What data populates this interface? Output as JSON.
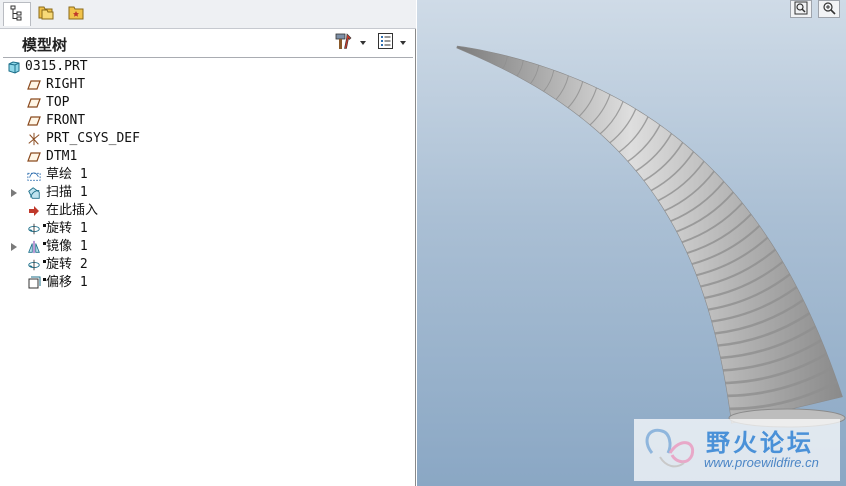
{
  "tabs": [
    {
      "id": "model-tree",
      "icon": "model-tree-tab-icon"
    },
    {
      "id": "folder-browser",
      "icon": "folder-browser-tab-icon"
    },
    {
      "id": "favorites",
      "icon": "favorites-tab-icon"
    }
  ],
  "panel": {
    "title": "模型树",
    "settings_icon": "tools-icon",
    "show_icon": "list-icon"
  },
  "tree": {
    "root": "0315.PRT",
    "items": [
      {
        "label": "RIGHT",
        "icon": "datum-plane-icon",
        "expandable": false,
        "marked": false
      },
      {
        "label": "TOP",
        "icon": "datum-plane-icon",
        "expandable": false,
        "marked": false
      },
      {
        "label": "FRONT",
        "icon": "datum-plane-icon",
        "expandable": false,
        "marked": false
      },
      {
        "label": "PRT_CSYS_DEF",
        "icon": "coordinate-system-icon",
        "expandable": false,
        "marked": false
      },
      {
        "label": "DTM1",
        "icon": "datum-plane-icon",
        "expandable": false,
        "marked": false
      },
      {
        "label": "草绘 1",
        "icon": "sketch-icon",
        "expandable": false,
        "marked": false
      },
      {
        "label": "扫描 1",
        "icon": "sweep-icon",
        "expandable": true,
        "marked": false
      },
      {
        "label": "在此插入",
        "icon": "insert-here-arrow-icon",
        "expandable": false,
        "marked": false
      },
      {
        "label": "旋转 1",
        "icon": "revolve-icon",
        "expandable": false,
        "marked": true
      },
      {
        "label": "镜像 1",
        "icon": "mirror-icon",
        "expandable": true,
        "marked": true
      },
      {
        "label": "旋转 2",
        "icon": "revolve-icon",
        "expandable": false,
        "marked": true
      },
      {
        "label": "偏移 1",
        "icon": "offset-icon",
        "expandable": false,
        "marked": true
      }
    ]
  },
  "viewport": {
    "buttons": [
      {
        "icon": "zoom-fit-icon"
      },
      {
        "icon": "zoom-in-icon"
      }
    ]
  },
  "watermark": {
    "title": "野火论坛",
    "url": "www.proewildfire.cn"
  },
  "colors": {
    "model_surface": "#b3b3b3",
    "view_top": "#cfdbe7",
    "view_bottom": "#8aa7c4",
    "watermark": "#4a91d8"
  }
}
